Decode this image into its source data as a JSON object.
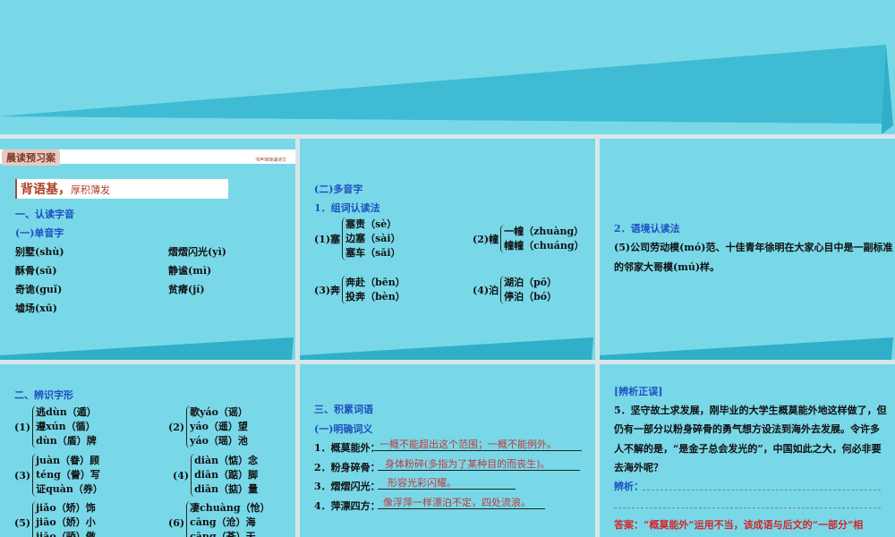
{
  "s1": {
    "header_tab": "晨读预习案",
    "header_right": "书声琅琅诵诗文",
    "banner_main": "背语基，",
    "banner_sub": "厚积薄发",
    "h1": "一、认读字音",
    "h2": "(一)单音字",
    "items": [
      "别墅(shù)",
      "熠熠闪光(yì)",
      "酥骨(sū)",
      "静谧(mì)",
      "奇诡(guǐ)",
      "贫瘠(jí)",
      "墟场(xū)"
    ]
  },
  "s2": {
    "h1": "(二)多音字",
    "h2": "1．组词认读法",
    "g1": {
      "label": "(1)塞",
      "lines": [
        "塞责（sè）",
        "边塞（sài）",
        "塞车（sāi）"
      ]
    },
    "g2": {
      "label": "(2)幢",
      "lines": [
        "一幢（zhuàng）",
        "幢幢（chuáng）"
      ]
    },
    "g3": {
      "label": "(3)奔",
      "lines": [
        "奔赴（bēn）",
        "投奔（bèn）"
      ]
    },
    "g4": {
      "label": "(4)泊",
      "lines": [
        "湖泊（pō）",
        "停泊（bó）"
      ]
    }
  },
  "s3": {
    "h1": "2．语境认读法",
    "p1": "(5)公司劳动模(mó)范、十佳青年徐明在大家心目中是一副标准",
    "p2": "的邻家大哥模(mú)样。"
  },
  "s4": {
    "h1": "二、辨识字形",
    "g1": {
      "label": "(1)",
      "lines": [
        "逃dùn（遁）",
        "遵xún（循）",
        "dùn（盾）牌"
      ]
    },
    "g2": {
      "label": "(2)",
      "lines": [
        "歌yáo（谣）",
        "yáo（遥）望",
        "yáo（瑶）池"
      ]
    },
    "g3": {
      "label": "(3)",
      "lines": [
        "juàn（眷）顾",
        "téng（誊）写",
        "证quàn（券）"
      ]
    },
    "g4": {
      "label": "(4)",
      "lines": [
        "diàn（惦）念",
        "diān（踮）脚",
        "diān（掂）量"
      ]
    },
    "g5": {
      "label": "(5)",
      "lines": [
        "jiǎo（矫）饰",
        "jiāo（娇）小",
        "jiāo（骄）傲"
      ]
    },
    "g6": {
      "label": "(6)",
      "lines": [
        "凄chuàng（怆）",
        "cāng（沧）海",
        "cāng（苍）天"
      ]
    }
  },
  "s5": {
    "h1": "三、积累词语",
    "h2": "(一)明确词义",
    "items": [
      {
        "q": "1．概莫能外：",
        "a": "一概不能超出这个范围；一概不能例外。"
      },
      {
        "q": "2．粉身碎骨：",
        "a": "身体粉碎(多指为了某种目的而丧生)。"
      },
      {
        "q": "3．熠熠闪光：",
        "a": "形容光彩闪耀。"
      },
      {
        "q": "4．萍漂四方：",
        "a": "像浮萍一样漂泊不定，四处流浪。"
      }
    ]
  },
  "s6": {
    "h1": "[辨析正误]",
    "lines": [
      "5．坚守故土求发展，刚毕业的大学生概莫能外地这样做了，但",
      "仍有一部分以粉身碎骨的勇气想方设法到海外去发展。令许多",
      "人不解的是，“是金子总会发光的”，中国如此之大，何必非要",
      "去海外呢？"
    ],
    "label": "辨析：",
    "answer": "答案：“概莫能外”运用不当，该成语与后文的“一部分”相"
  }
}
